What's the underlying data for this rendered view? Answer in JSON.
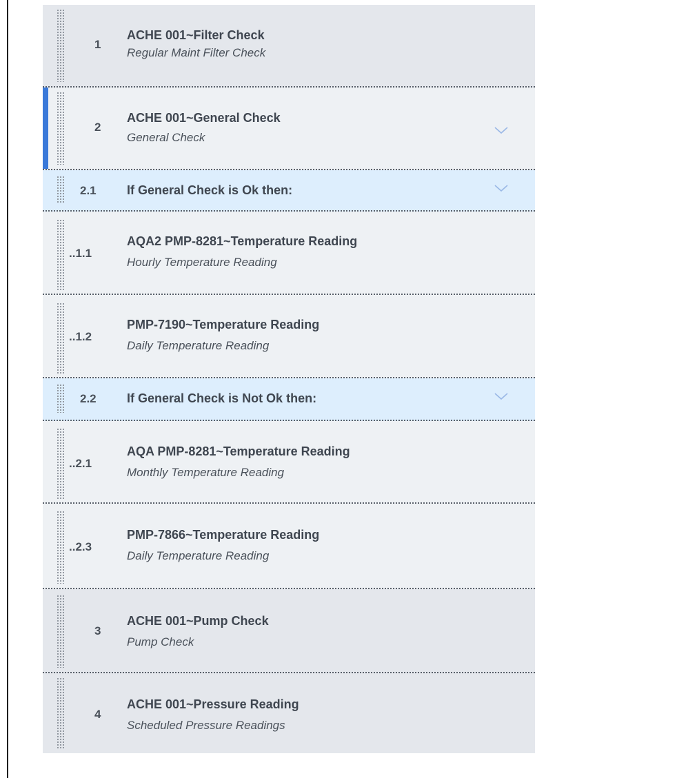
{
  "items": [
    {
      "num": "1",
      "title": "ACHE 001~Filter Check",
      "description": "Regular Maint Filter Check"
    },
    {
      "num": "2",
      "title": "ACHE 001~General Check",
      "description": "General Check"
    },
    {
      "num": "2.1",
      "title": "If General Check is Ok then:"
    },
    {
      "num": "..1.1",
      "title": "AQA2 PMP-8281~Temperature Reading",
      "description": "Hourly Temperature Reading"
    },
    {
      "num": "..1.2",
      "title": "PMP-7190~Temperature Reading",
      "description": "Daily Temperature Reading"
    },
    {
      "num": "2.2",
      "title": "If General Check is Not Ok then:"
    },
    {
      "num": "..2.1",
      "title": "AQA PMP-8281~Temperature Reading",
      "description": "Monthly Temperature Reading"
    },
    {
      "num": "..2.3",
      "title": "PMP-7866~Temperature Reading",
      "description": "Daily Temperature Reading"
    },
    {
      "num": "3",
      "title": "ACHE 001~Pump Check",
      "description": "Pump Check"
    },
    {
      "num": "4",
      "title": "ACHE 001~Pressure Reading",
      "description": "Scheduled Pressure Readings"
    }
  ],
  "colors": {
    "accent": "#3a79d9",
    "top_level_row_bg": "#e4e7ec",
    "sub_row_bg": "#eef1f4",
    "condition_row_bg": "#ddeefd",
    "chevron": "#9ab8e6"
  },
  "icons": {
    "drag_handle": "drag-handle-icon",
    "expand": "chevron-down-icon"
  }
}
